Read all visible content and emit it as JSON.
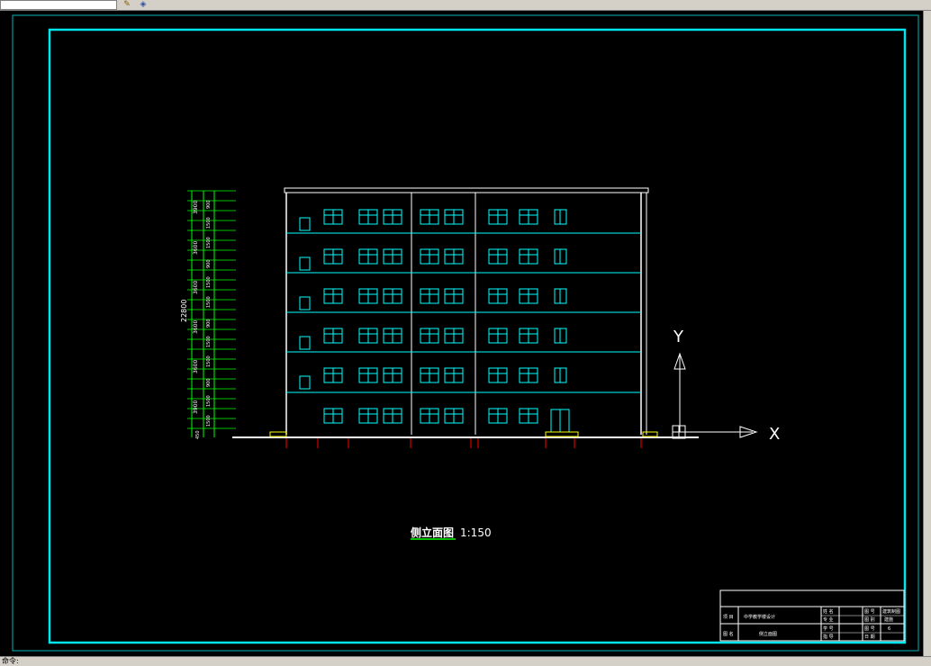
{
  "toolbar": {
    "layer_field_value": "",
    "icons": [
      "pencil-icon",
      "layer-icon"
    ]
  },
  "drawing": {
    "title_text": "侧立面图",
    "scale_text": "1:150",
    "ucs_x_label": "X",
    "ucs_y_label": "Y",
    "total_height_dim": "22800",
    "floor_height_dims": [
      "3900",
      "3600",
      "3600",
      "3600",
      "3600",
      "3900"
    ],
    "base_dim": "450",
    "sub_dims": [
      "900",
      "1500",
      "1500",
      "900",
      "1500",
      "1500"
    ],
    "colors": {
      "frame": "#00e5ee",
      "cyan": "#00ffff",
      "green": "#00ff00",
      "red": "#ff0000",
      "yellow": "#ffff00",
      "white": "#ffffff"
    }
  },
  "title_block": {
    "r1c1": "项 目",
    "r1c2": "中学教学楼设计",
    "r2c1": "图 名",
    "r2c2": "侧立面图",
    "k1": "姓 名",
    "k2": "专 业",
    "k3": "学 号",
    "k4": "指 导",
    "v1": "建筑制图",
    "v2": "建施",
    "v3": "6",
    "labels_right": [
      "图 号",
      "图 别",
      "图 号",
      "日 期"
    ]
  },
  "statusbar": {
    "text": "命令:"
  }
}
